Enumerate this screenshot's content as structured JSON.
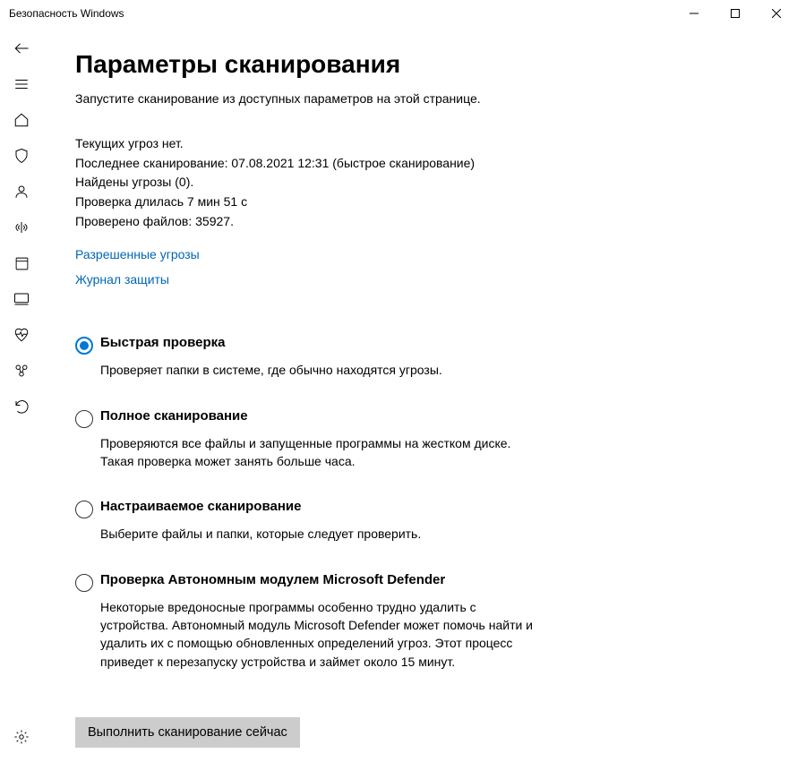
{
  "window": {
    "title": "Безопасность Windows"
  },
  "page": {
    "heading": "Параметры сканирования",
    "subtitle": "Запустите сканирование из доступных параметров на этой странице."
  },
  "status": {
    "no_threats": "Текущих угроз нет.",
    "last_scan": "Последнее сканирование: 07.08.2021 12:31 (быстрое сканирование)",
    "threats_found": "Найдены угрозы (0).",
    "duration": "Проверка длилась 7 мин 51 с",
    "files_scanned": "Проверено файлов: 35927."
  },
  "links": {
    "allowed_threats": "Разрешенные угрозы",
    "protection_history": "Журнал защиты"
  },
  "options": {
    "quick": {
      "title": "Быстрая проверка",
      "desc": "Проверяет папки в системе, где обычно находятся угрозы.",
      "selected": true
    },
    "full": {
      "title": "Полное сканирование",
      "desc": "Проверяются все файлы и запущенные программы на жестком диске. Такая проверка может занять больше часа."
    },
    "custom": {
      "title": "Настраиваемое сканирование",
      "desc": "Выберите файлы и папки, которые следует проверить."
    },
    "offline": {
      "title": "Проверка Автономным модулем Microsoft Defender",
      "desc": "Некоторые вредоносные программы особенно трудно удалить с устройства. Автономный модуль Microsoft Defender может помочь найти и удалить их с помощью обновленных определений угроз. Этот процесс приведет к перезапуску устройства и займет около 15 минут."
    }
  },
  "buttons": {
    "scan_now": "Выполнить сканирование сейчас"
  }
}
